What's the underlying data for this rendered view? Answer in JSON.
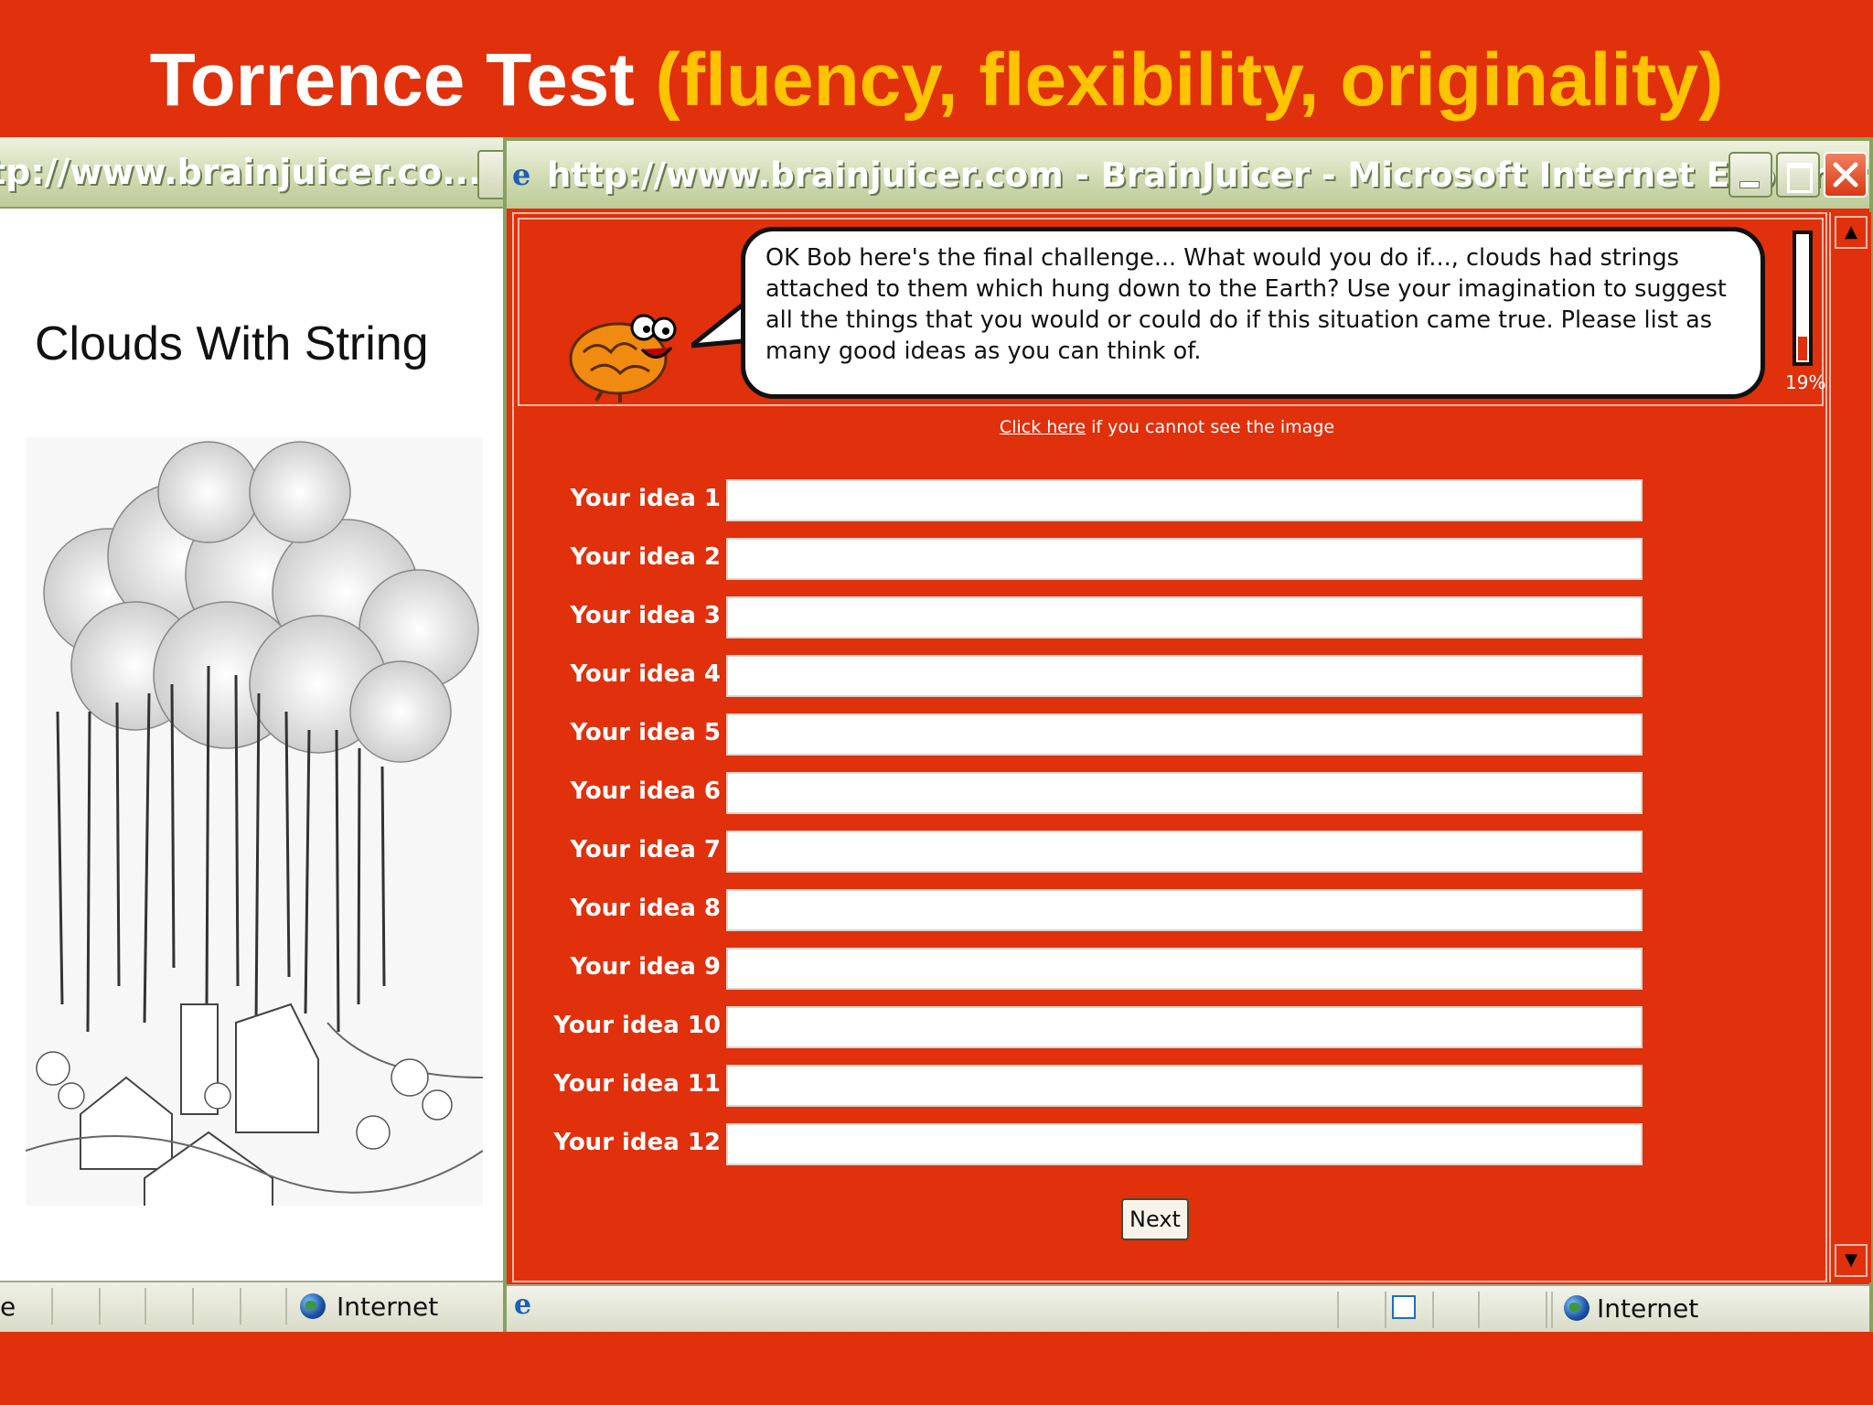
{
  "slide": {
    "title_main": "Torrence Test",
    "title_sub": "(fluency, flexibility, originality)"
  },
  "back_window": {
    "title": "tp://www.brainjuicer.co...",
    "image_caption": "Clouds With String",
    "status_left": "e",
    "status_zone": "Internet"
  },
  "front_window": {
    "title": "http://www.brainjuicer.com - BrainJuicer - Microsoft Internet Explorer",
    "bubble_text": "OK Bob here's the final challenge... What would you do if..., clouds had strings attached to them which hung down to the Earth? Use your imagination to suggest all the things that you would or could do if this situation came true. Please list as many good ideas as you can think of.",
    "progress_label": "19%",
    "progress_value": 0.19,
    "hint_link": "Click here",
    "hint_text": " if you cannot see the image",
    "ideas": [
      {
        "label": "Your idea 1",
        "value": ""
      },
      {
        "label": "Your idea 2",
        "value": ""
      },
      {
        "label": "Your idea 3",
        "value": ""
      },
      {
        "label": "Your idea 4",
        "value": ""
      },
      {
        "label": "Your idea 5",
        "value": ""
      },
      {
        "label": "Your idea 6",
        "value": ""
      },
      {
        "label": "Your idea 7",
        "value": ""
      },
      {
        "label": "Your idea 8",
        "value": ""
      },
      {
        "label": "Your idea 9",
        "value": ""
      },
      {
        "label": "Your idea 10",
        "value": ""
      },
      {
        "label": "Your idea 11",
        "value": ""
      },
      {
        "label": "Your idea 12",
        "value": ""
      }
    ],
    "next_label": "Next",
    "status_zone": "Internet"
  },
  "colors": {
    "background": "#e0300c",
    "title_sub": "#ffc400",
    "titlebar": "#cfd9b0"
  },
  "icons": {
    "app": "ie-icon",
    "mascot": "brain-mascot-icon",
    "zone": "globe-icon",
    "close": "close-icon",
    "minimize": "minimize-icon",
    "maximize": "maximize-icon"
  }
}
